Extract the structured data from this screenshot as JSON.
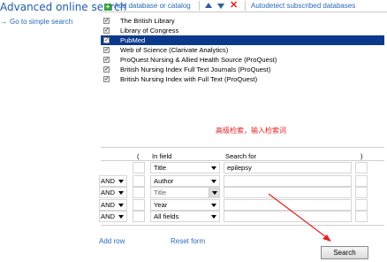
{
  "sidebar": {
    "title": "Advanced online search",
    "simple_link": "Go to simple search"
  },
  "toolbar": {
    "add_label": "Add database or catalog",
    "autodetect_label": "Autodetect subscribed databases"
  },
  "databases": [
    {
      "name": "The British Library",
      "checked": true,
      "selected": false
    },
    {
      "name": "Library of Congress",
      "checked": true,
      "selected": false
    },
    {
      "name": "PubMed",
      "checked": true,
      "selected": true
    },
    {
      "name": "Web of Science (Clarivate Analytics)",
      "checked": true,
      "selected": false
    },
    {
      "name": "ProQuest Nursing & Allied Health Source (ProQuest)",
      "checked": true,
      "selected": false
    },
    {
      "name": "British Nursing Index Full Text Journals (ProQuest)",
      "checked": true,
      "selected": false
    },
    {
      "name": "British Nursing Index with Full Text (ProQuest)",
      "checked": true,
      "selected": false
    }
  ],
  "annotation": "高级检索，输入检索词",
  "builder": {
    "headers": {
      "open_paren": "(",
      "in_field": "In field",
      "search_for": "Search for",
      "close_paren": ")"
    },
    "rows": [
      {
        "bool": "",
        "field": "Title",
        "term": "epilepsy"
      },
      {
        "bool": "AND",
        "field": "Author",
        "term": ""
      },
      {
        "bool": "AND",
        "field": "Title",
        "term": ""
      },
      {
        "bool": "AND",
        "field": "Year",
        "term": ""
      },
      {
        "bool": "AND",
        "field": "All fields",
        "term": ""
      }
    ]
  },
  "actions": {
    "add_row": "Add row",
    "reset_form": "Reset form",
    "search": "Search"
  },
  "colors": {
    "link": "#2a6ab5",
    "selected_row": "#0b3a8c",
    "annotation": "#e02020"
  }
}
